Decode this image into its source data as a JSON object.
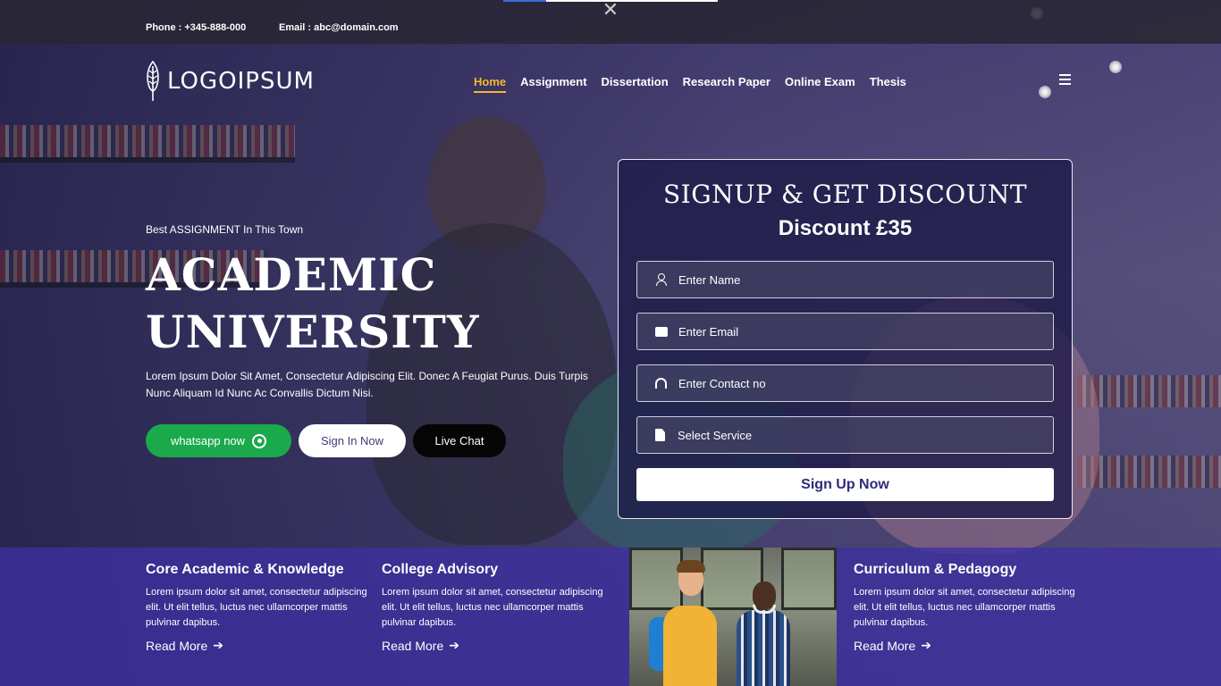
{
  "topbar": {
    "phone": "Phone : +345-888-000",
    "email": "Email : abc@domain.com",
    "progress_fraction": 0.2
  },
  "header": {
    "logo_text": "LOGOIPSUM",
    "nav": [
      {
        "label": "Home",
        "active": true
      },
      {
        "label": "Assignment",
        "active": false
      },
      {
        "label": "Dissertation",
        "active": false
      },
      {
        "label": "Research Paper",
        "active": false
      },
      {
        "label": "Online Exam",
        "active": false
      },
      {
        "label": "Thesis",
        "active": false
      }
    ],
    "accent_color": "#f5b82e"
  },
  "hero": {
    "tagline": "Best ASSIGNMENT In This Town",
    "title_line1": "ACADEMIC",
    "title_line2": "UNIVERSITY",
    "description": "Lorem Ipsum Dolor Sit Amet, Consectetur Adipiscing Elit. Donec A Feugiat Purus. Duis Turpis Nunc Aliquam Id Nunc Ac Convallis Dictum Nisi.",
    "buttons": {
      "whatsapp": "whatsapp now",
      "signin": "Sign In Now",
      "chat": "Live Chat"
    },
    "whatsapp_color": "#1aaa4b"
  },
  "signup": {
    "title": "SIGNUP & GET DISCOUNT",
    "discount": "Discount £35",
    "fields": {
      "name": "Enter Name",
      "email": "Enter Email",
      "contact": "Enter Contact no",
      "service": "Select Service"
    },
    "submit": "Sign Up Now"
  },
  "features": [
    {
      "title": "Core Academic & Knowledge",
      "text": "Lorem ipsum dolor sit amet, consectetur adipiscing elit. Ut elit tellus, luctus nec ullamcorper mattis pulvinar dapibus.",
      "link": "Read More"
    },
    {
      "title": "College Advisory",
      "text": "Lorem ipsum dolor sit amet, consectetur adipiscing elit. Ut elit tellus, luctus nec ullamcorper mattis pulvinar dapibus.",
      "link": "Read More"
    },
    {
      "title": "Curriculum & Pedagogy",
      "text": "Lorem ipsum dolor sit amet, consectetur adipiscing elit. Ut elit tellus, luctus nec ullamcorper mattis pulvinar dapibus.",
      "link": "Read More"
    }
  ],
  "icons": {
    "close": "close-icon",
    "menu": "hamburger-menu-icon",
    "whatsapp": "whatsapp-icon",
    "user": "user-icon",
    "mail": "mail-icon",
    "phone": "headset-icon",
    "service": "document-icon",
    "arrow": "arrow-right-icon"
  }
}
